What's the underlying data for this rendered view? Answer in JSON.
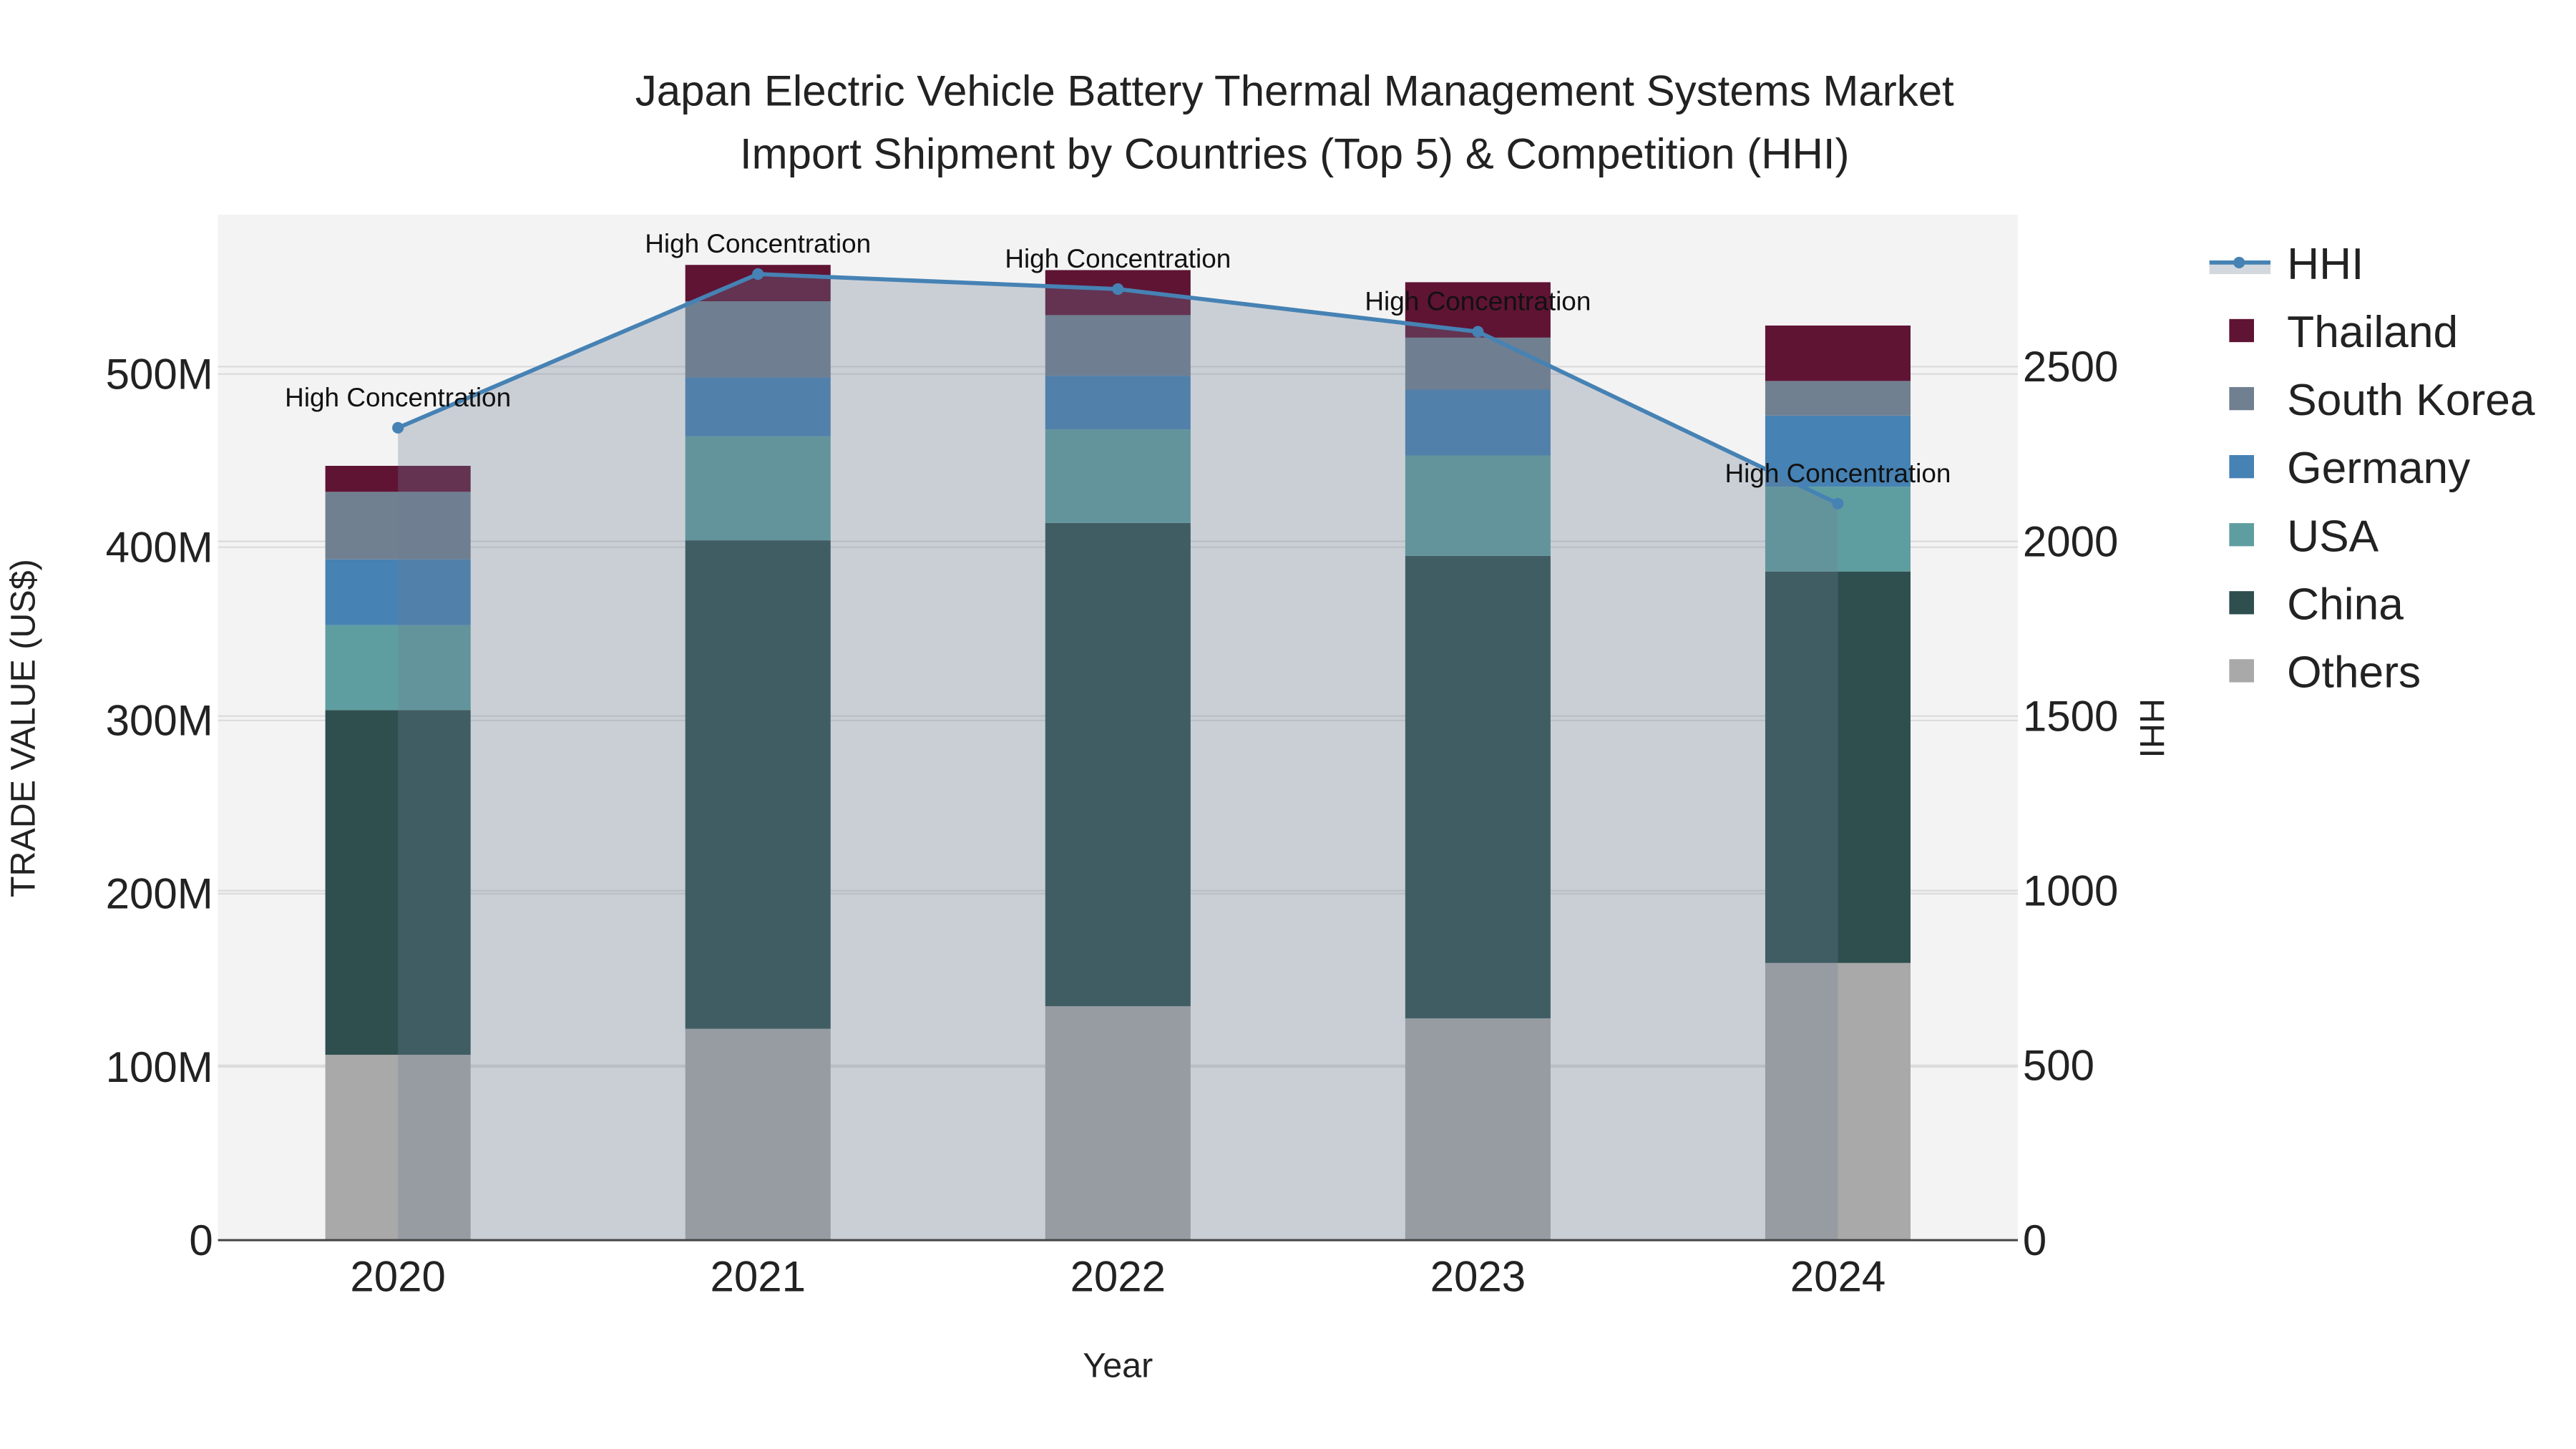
{
  "chart_data": {
    "type": "bar",
    "stacked": true,
    "title_line1": "Japan Electric Vehicle Battery Thermal Management Systems Market",
    "title_line2": "Import Shipment by Countries (Top 5) & Competition (HHI)",
    "xlabel": "Year",
    "ylabel": "TRADE VALUE (US$)",
    "y2label": "HHI",
    "categories": [
      "2020",
      "2021",
      "2022",
      "2023",
      "2024"
    ],
    "ylim": [
      0,
      592
    ],
    "y_unit": "M",
    "yticks": [
      0,
      100,
      200,
      300,
      400,
      500
    ],
    "ytick_labels": [
      "0",
      "100M",
      "200M",
      "300M",
      "400M",
      "500M"
    ],
    "y2lim": [
      0,
      2935
    ],
    "y2ticks": [
      0,
      500,
      1000,
      1500,
      2000,
      2500
    ],
    "y2tick_labels": [
      "0",
      "500",
      "1000",
      "1500",
      "2000",
      "2500"
    ],
    "series": [
      {
        "name": "Others",
        "color": "#a9a9a9",
        "values": [
          107,
          122,
          135,
          128,
          160
        ]
      },
      {
        "name": "China",
        "color": "#2f4f4f",
        "values": [
          199,
          282,
          279,
          267,
          226
        ]
      },
      {
        "name": "USA",
        "color": "#5f9ea0",
        "values": [
          49,
          60,
          54,
          58,
          49
        ]
      },
      {
        "name": "Germany",
        "color": "#4682b4",
        "values": [
          38,
          34,
          31,
          38,
          41
        ]
      },
      {
        "name": "South Korea",
        "color": "#708090",
        "values": [
          39,
          44,
          35,
          30,
          20
        ]
      },
      {
        "name": "Thailand",
        "color": "#5f1434",
        "values": [
          15,
          21,
          26,
          32,
          32
        ]
      }
    ],
    "hhi": {
      "name": "HHI",
      "color": "#4682b4",
      "values": [
        2325,
        2765,
        2722,
        2600,
        2108
      ],
      "annotations": [
        "High Concentration",
        "High Concentration",
        "High Concentration",
        "High Concentration",
        "High Concentration"
      ]
    },
    "legend": [
      "HHI",
      "Thailand",
      "South Korea",
      "Germany",
      "USA",
      "China",
      "Others"
    ],
    "legend_placement": "right",
    "grid": true
  }
}
